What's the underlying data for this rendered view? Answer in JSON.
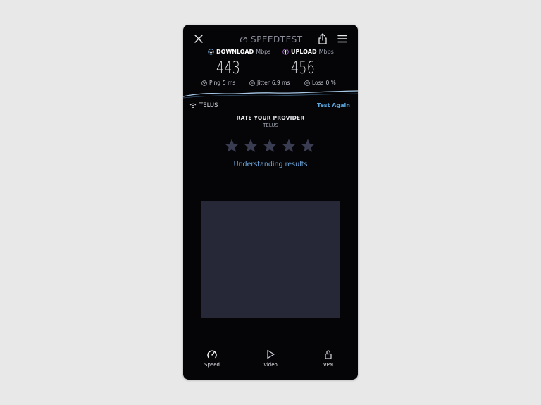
{
  "app": {
    "brand": "SPEEDTEST"
  },
  "results": {
    "download": {
      "label": "DOWNLOAD",
      "unit": "Mbps",
      "value": "443"
    },
    "upload": {
      "label": "UPLOAD",
      "unit": "Mbps",
      "value": "456"
    },
    "ping": {
      "label": "Ping",
      "value": "5 ms"
    },
    "jitter": {
      "label": "Jitter",
      "value": "6.9 ms"
    },
    "loss": {
      "label": "Loss",
      "value": "0 %"
    }
  },
  "provider": {
    "name": "TELUS",
    "test_again": "Test Again"
  },
  "rating": {
    "title": "RATE YOUR PROVIDER",
    "provider": "TELUS",
    "stars": 5,
    "selected": 0
  },
  "links": {
    "understanding": "Understanding results"
  },
  "nav": {
    "speed": "Speed",
    "video": "Video",
    "vpn": "VPN"
  },
  "colors": {
    "background": "#050507",
    "accent_blue": "#6fa8dc",
    "star_inactive": "#3a3d52",
    "ad_placeholder": "#262737"
  }
}
